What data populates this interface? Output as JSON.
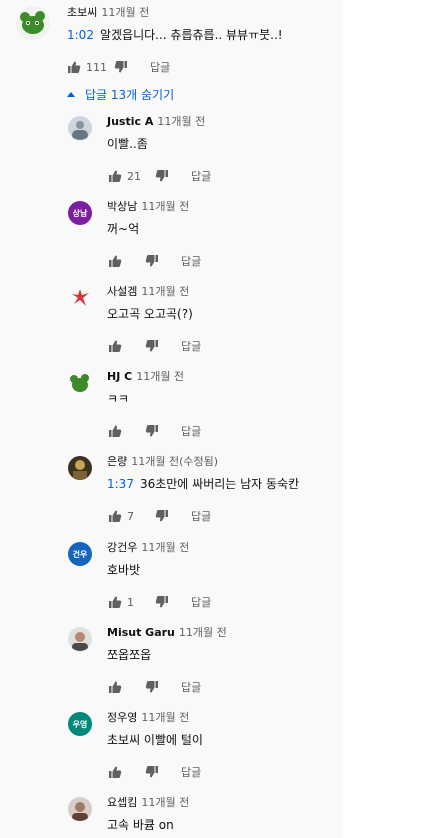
{
  "top_comment": {
    "author": "초보씨",
    "time": "11개월 전",
    "timestamp": "1:02",
    "text": "알겠읍니다... 츄릅츄릅.. 뷰뷰ㅠ붓..!",
    "likes": "111",
    "reply_label": "답글"
  },
  "replies_toggle": {
    "label": "답글 13개 숨기기"
  },
  "replies": [
    {
      "author": "Justic A",
      "time": "11개월 전",
      "text": "이빨..좀",
      "likes": "21",
      "reply_label": "답글"
    },
    {
      "author": "박상남",
      "time": "11개월 전",
      "text": "꺼~억",
      "likes": "",
      "reply_label": "답글",
      "avatar_text": "상남",
      "avatar_color": "#7b1fa2"
    },
    {
      "author": "사설겜",
      "time": "11개월 전",
      "text": "오고곡 오고곡(?)",
      "likes": "",
      "reply_label": "답글"
    },
    {
      "author": "HJ C",
      "time": "11개월 전",
      "text": "ㅋㅋ",
      "likes": "",
      "reply_label": "답글"
    },
    {
      "author": "은량",
      "time": "11개월 전(수정됨)",
      "timestamp": "1:37",
      "text": "36초만에 싸버리는 남자 동숙칸",
      "likes": "7",
      "reply_label": "답글"
    },
    {
      "author": "강건우",
      "time": "11개월 전",
      "text": "호바밧",
      "likes": "1",
      "reply_label": "답글",
      "avatar_text": "건우",
      "avatar_color": "#1565c0"
    },
    {
      "author": "Misut Garu",
      "time": "11개월 전",
      "text": "쪼옵쪼옵",
      "likes": "",
      "reply_label": "답글"
    },
    {
      "author": "정우영",
      "time": "11개월 전",
      "text": "초보씨 이빨에 털이",
      "likes": "",
      "reply_label": "답글",
      "avatar_text": "우영",
      "avatar_color": "#00897b"
    },
    {
      "author": "요셉킴",
      "time": "11개월 전",
      "text": "고속 바큠 on"
    }
  ]
}
